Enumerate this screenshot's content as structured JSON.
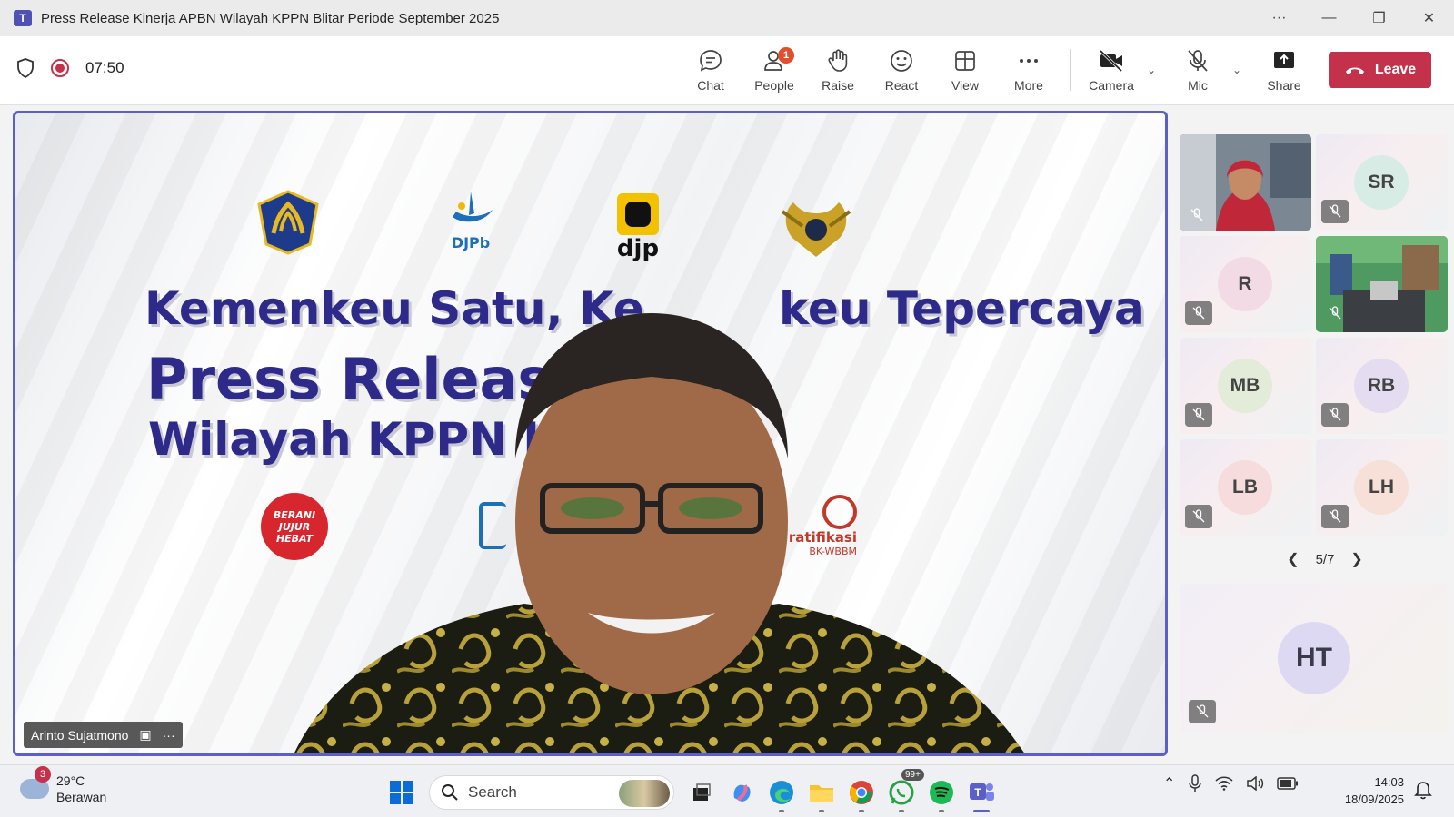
{
  "window": {
    "title": "Press Release Kinerja APBN Wilayah KPPN Blitar Periode September 2025",
    "app_icon_letter": "T"
  },
  "meeting": {
    "timer": "07:50"
  },
  "toolbar": {
    "chat": "Chat",
    "people": "People",
    "people_badge": "1",
    "raise": "Raise",
    "react": "React",
    "view": "View",
    "more": "More",
    "camera": "Camera",
    "mic": "Mic",
    "share": "Share",
    "leave": "Leave"
  },
  "slide": {
    "line1": "Kemenkeu Satu, Ke",
    "line1b": "keu Tepercaya",
    "line2": "Press Release",
    "line3": "Wilayah KPPN I",
    "djpb_logo_text": "DJPb",
    "djp_logo_text": "djp",
    "badge_text": "BERANI JUJUR HEBAT",
    "gratifikasi_text": "ratifikasi",
    "wbbm_text": "BK-WBBM"
  },
  "speaker": {
    "name": "Arinto Sujatmono"
  },
  "participants": [
    {
      "initials": "",
      "video": true
    },
    {
      "initials": "SR",
      "color": "#d7ece4"
    },
    {
      "initials": "R",
      "color": "#f3dbe6"
    },
    {
      "initials": "",
      "video": true
    },
    {
      "initials": "MB",
      "color": "#e2ecd8"
    },
    {
      "initials": "RB",
      "color": "#e4dcf0"
    },
    {
      "initials": "LB",
      "color": "#f6dcdc"
    },
    {
      "initials": "LH",
      "color": "#f6e0d8"
    }
  ],
  "pager": "5/7",
  "featured_participant": {
    "initials": "HT",
    "color": "#ddd9f2"
  },
  "taskbar": {
    "weather_badge": "3",
    "temperature": "29°C",
    "weather_desc": "Berawan",
    "search_placeholder": "Search",
    "whatsapp_badge": "99+",
    "time": "14:03",
    "date": "18/09/2025"
  }
}
